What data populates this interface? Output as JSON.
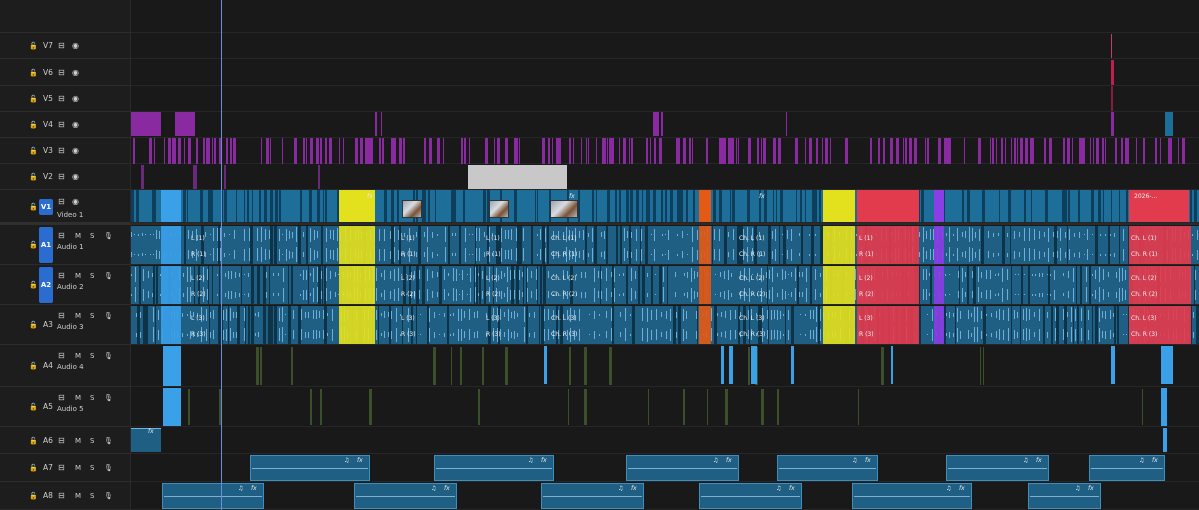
{
  "video_tracks": [
    {
      "id": "V7",
      "label": "V7",
      "name": ""
    },
    {
      "id": "V6",
      "label": "V6",
      "name": ""
    },
    {
      "id": "V5",
      "label": "V5",
      "name": ""
    },
    {
      "id": "V4",
      "label": "V4",
      "name": ""
    },
    {
      "id": "V3",
      "label": "V3",
      "name": ""
    },
    {
      "id": "V2",
      "label": "V2",
      "name": ""
    },
    {
      "id": "V1",
      "label": "V1",
      "name": "Video 1"
    }
  ],
  "audio_tracks": [
    {
      "id": "A1",
      "label": "A1",
      "name": "Audio 1",
      "m": "M",
      "s": "S"
    },
    {
      "id": "A2",
      "label": "A2",
      "name": "Audio 2",
      "m": "M",
      "s": "S"
    },
    {
      "id": "A3",
      "label": "A3",
      "name": "Audio 3",
      "m": "M",
      "s": "S"
    },
    {
      "id": "A4",
      "label": "A4",
      "name": "Audio 4",
      "m": "M",
      "s": "S"
    },
    {
      "id": "A5",
      "label": "A5",
      "name": "Audio 5",
      "m": "M",
      "s": "S"
    },
    {
      "id": "A6",
      "label": "A6",
      "name": "",
      "m": "M",
      "s": "S"
    },
    {
      "id": "A7",
      "label": "A7",
      "name": "",
      "m": "M",
      "s": "S"
    },
    {
      "id": "A8",
      "label": "A8",
      "name": "",
      "m": "M",
      "s": "S"
    }
  ],
  "clip_labels": {
    "fx": "fx",
    "v1_end": "2026-...",
    "a1_l1": "L (1)",
    "a1_chl1": "Ch. L (1)",
    "a1_r1": "R (1)",
    "a1_chr1": "Ch. R (1)",
    "a2_l2": "L (2)",
    "a2_chl2": "Ch. L (2)",
    "a2_r2": "R (2)",
    "a2_chr2": "Ch. R (2)",
    "a3_l3": "L (3)",
    "a3_chl3": "Ch. L (3)",
    "a3_r3": "R (3)",
    "a3_chr3": "Ch. R (3)",
    "music_icon": "♫"
  },
  "colors": {
    "clip_blue": "#1e6e9a",
    "audio_blue": "#1f5f84",
    "purple": "#8a2aa0",
    "yellow": "#e3e01e",
    "orange": "#e25a16",
    "red": "#e33b4e",
    "violet": "#8a3ee6",
    "light_blue": "#3aa0e8",
    "gray_clip": "#c8c8c8",
    "badge": "#2b6cd1"
  }
}
